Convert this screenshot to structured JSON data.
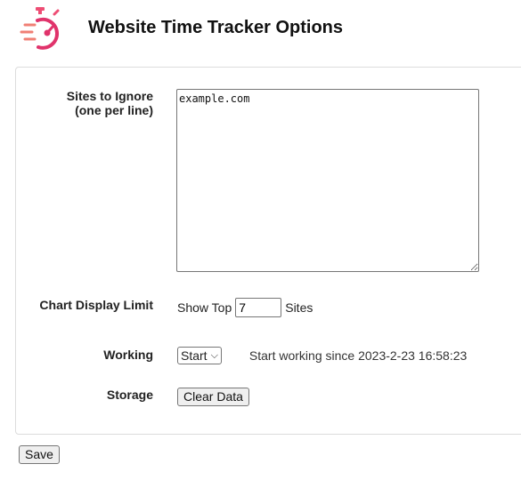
{
  "header": {
    "title": "Website Time Tracker Options",
    "logo_icon": "stopwatch-icon",
    "accent_color": "#e0336b"
  },
  "options": {
    "ignore": {
      "label_line1": "Sites to Ignore",
      "label_line2": "(one per line)",
      "value": "example.com"
    },
    "chart": {
      "label": "Chart Display Limit",
      "prefix": "Show Top",
      "value": "7",
      "suffix": "Sites"
    },
    "working": {
      "label": "Working",
      "select_value": "Start",
      "status_text": "Start working since 2023-2-23 16:58:23"
    },
    "storage": {
      "label": "Storage",
      "clear_label": "Clear Data"
    }
  },
  "footer": {
    "save_label": "Save"
  }
}
